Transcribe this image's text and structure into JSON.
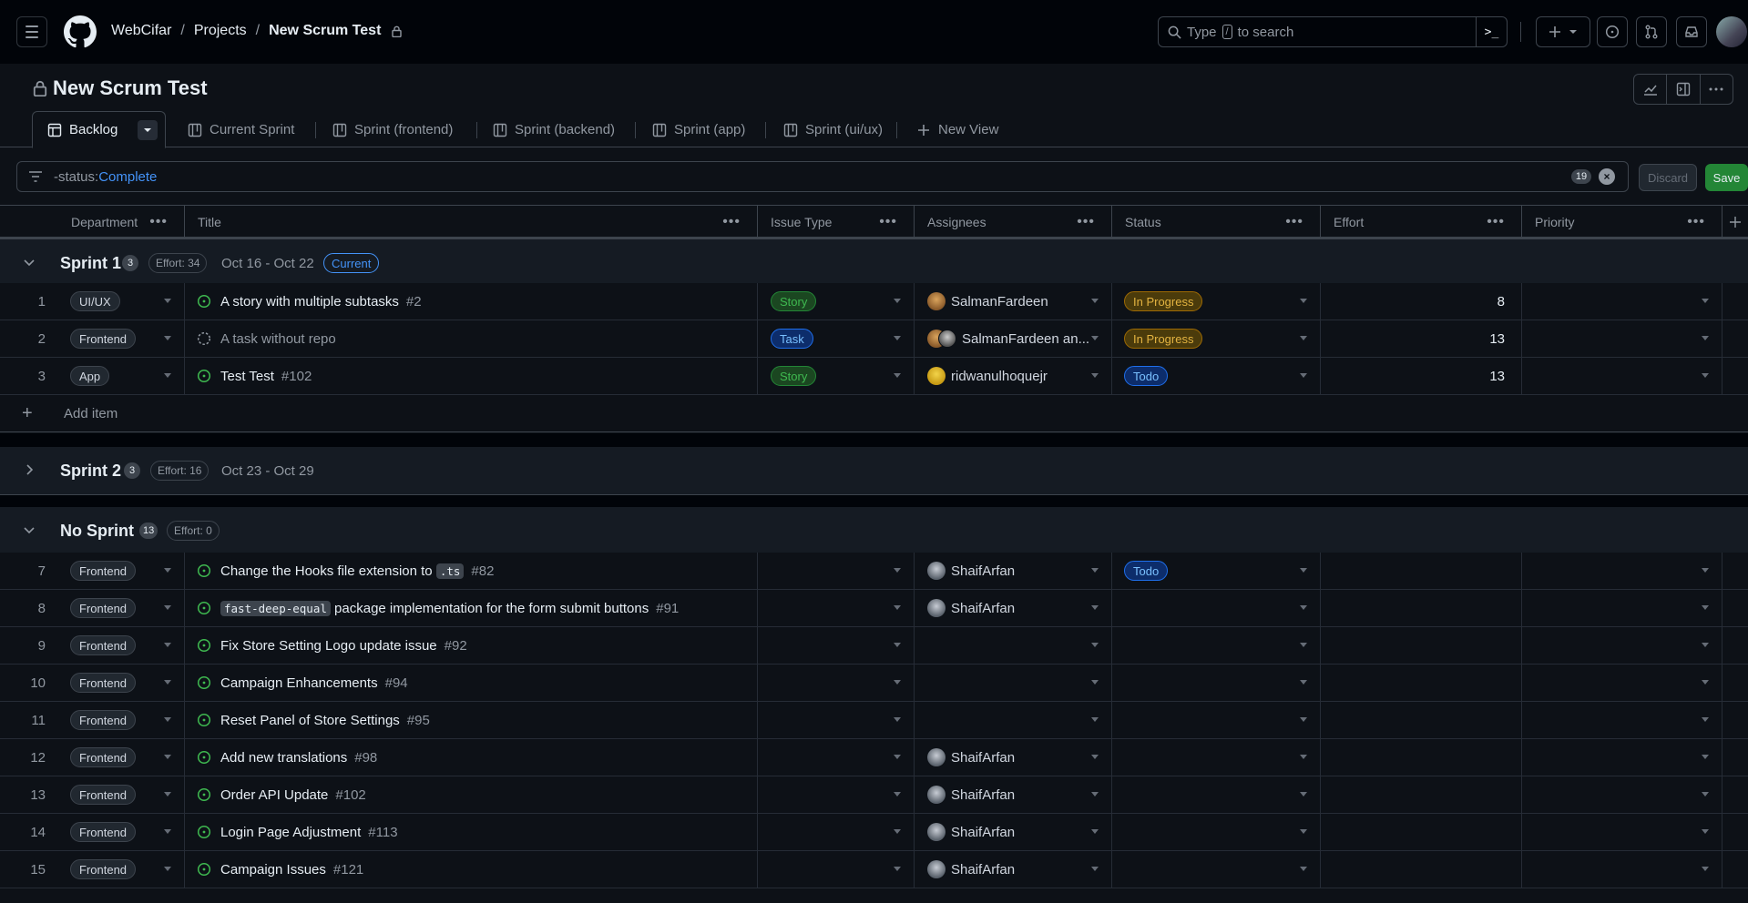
{
  "header": {
    "breadcrumbs": [
      "WebCifar",
      "Projects",
      "New Scrum Test"
    ],
    "separator": "/",
    "search_placeholder_pre": "Type",
    "search_key": "/",
    "search_placeholder_post": "to search"
  },
  "project": {
    "title": "New Scrum Test"
  },
  "tabs": [
    {
      "label": "Backlog",
      "icon": "table-icon",
      "active": true
    },
    {
      "label": "Current Sprint",
      "icon": "board-icon"
    },
    {
      "label": "Sprint (frontend)",
      "icon": "board-icon"
    },
    {
      "label": "Sprint (backend)",
      "icon": "board-icon"
    },
    {
      "label": "Sprint (app)",
      "icon": "board-icon"
    },
    {
      "label": "Sprint (ui/ux)",
      "icon": "board-icon"
    },
    {
      "label": "New View",
      "icon": "plus-icon"
    }
  ],
  "filter": {
    "prefix": "-status:",
    "value": "Complete",
    "count": "19",
    "discard_label": "Discard",
    "save_label": "Save"
  },
  "columns": [
    "Department",
    "Title",
    "Issue Type",
    "Assignees",
    "Status",
    "Effort",
    "Priority"
  ],
  "groups": [
    {
      "name": "Sprint 1",
      "count": "3",
      "effort": "Effort: 34",
      "dates": "Oct 16 - Oct 22",
      "badge": "Current",
      "expanded": true,
      "rows": [
        {
          "num": "1",
          "dept": "UI/UX",
          "title": "A story with multiple subtasks",
          "issue": "#2",
          "type": "Story",
          "assignee": "SalmanFardeen",
          "status": "In Progress",
          "effort": "8"
        },
        {
          "num": "2",
          "dept": "Frontend",
          "title": "A task without repo",
          "issue": "",
          "draft": true,
          "type": "Task",
          "assignee": "SalmanFardeen an...",
          "status": "In Progress",
          "effort": "13"
        },
        {
          "num": "3",
          "dept": "App",
          "title": "Test Test",
          "issue": "#102",
          "type": "Story",
          "assignee": "ridwanulhoquejr",
          "status": "Todo",
          "effort": "13"
        }
      ],
      "add_item": "Add item"
    },
    {
      "name": "Sprint 2",
      "count": "3",
      "effort": "Effort: 16",
      "dates": "Oct 23 - Oct 29",
      "expanded": false
    },
    {
      "name": "No Sprint",
      "count": "13",
      "effort": "Effort: 0",
      "expanded": true,
      "rows": [
        {
          "num": "7",
          "dept": "Frontend",
          "title_pre": "Change the Hooks file extension to ",
          "code": ".ts",
          "title": "",
          "issue": "#82",
          "assignee": "ShaifArfan",
          "status": "Todo"
        },
        {
          "num": "8",
          "dept": "Frontend",
          "code_first": "fast-deep-equal",
          "title": " package implementation for the form submit buttons",
          "issue": "#91",
          "assignee": "ShaifArfan"
        },
        {
          "num": "9",
          "dept": "Frontend",
          "title": "Fix Store Setting Logo update issue",
          "issue": "#92"
        },
        {
          "num": "10",
          "dept": "Frontend",
          "title": "Campaign Enhancements",
          "issue": "#94"
        },
        {
          "num": "11",
          "dept": "Frontend",
          "title": "Reset Panel of Store Settings",
          "issue": "#95"
        },
        {
          "num": "12",
          "dept": "Frontend",
          "title": "Add new translations",
          "issue": "#98",
          "assignee": "ShaifArfan"
        },
        {
          "num": "13",
          "dept": "Frontend",
          "title": "Order API Update",
          "issue": "#102",
          "assignee": "ShaifArfan"
        },
        {
          "num": "14",
          "dept": "Frontend",
          "title": "Login Page Adjustment",
          "issue": "#113",
          "assignee": "ShaifArfan"
        },
        {
          "num": "15",
          "dept": "Frontend",
          "title": "Campaign Issues",
          "issue": "#121",
          "assignee": "ShaifArfan"
        }
      ]
    }
  ],
  "colors": {
    "open_issue": "#3fb950",
    "accent": "#4493f8",
    "bg": "#0d1117"
  }
}
